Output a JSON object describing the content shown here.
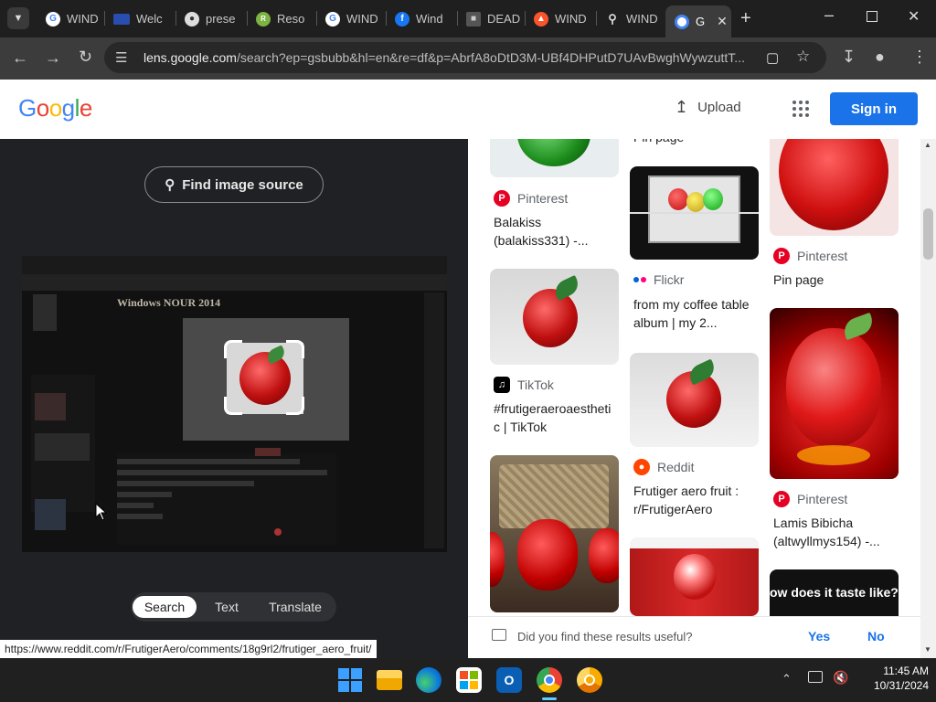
{
  "browser": {
    "tabs": [
      {
        "label": "WIND",
        "icon": "google-icon"
      },
      {
        "label": "Welc",
        "icon": "site-icon"
      },
      {
        "label": "prese",
        "icon": "globe-icon"
      },
      {
        "label": "Reso",
        "icon": "site-icon"
      },
      {
        "label": "WIND",
        "icon": "google-icon"
      },
      {
        "label": "Wind",
        "icon": "facebook-icon"
      },
      {
        "label": "DEAD",
        "icon": "site-icon"
      },
      {
        "label": "WIND",
        "icon": "brave-icon"
      },
      {
        "label": "WIND",
        "icon": "search-icon"
      },
      {
        "label": "G",
        "icon": "google-lens-icon",
        "active": true
      }
    ],
    "url_host": "lens.google.com",
    "url_path": "/search?ep=gsbubb&hl=en&re=df&p=AbrfA8oDtD3M-UBf4DHPutD7UAvBwghWywzuttT..."
  },
  "header": {
    "logo": "Google",
    "upload_label": "Upload",
    "signin_label": "Sign in"
  },
  "lens": {
    "find_source_label": "Find image source",
    "modes": [
      "Search",
      "Text",
      "Translate"
    ],
    "active_mode": "Search",
    "preview_window_title": "Windows NOUR 2014"
  },
  "results": {
    "col1": [
      {
        "source": "Pinterest",
        "title": "Balakiss (balakiss331) -..."
      },
      {
        "source": "TikTok",
        "title": "#frutigeraeroaesthetic | TikTok"
      }
    ],
    "col2": [
      {
        "title_partial": "Pin page"
      },
      {
        "source": "Flickr",
        "title": "from my coffee table album | my 2..."
      },
      {
        "source": "Reddit",
        "title": "Frutiger aero fruit : r/FrutigerAero"
      }
    ],
    "col3": [
      {
        "source": "Pinterest",
        "title": "Pin page"
      },
      {
        "source": "Pinterest",
        "title": "Lamis Bibicha (altwyllmys154) -..."
      },
      {
        "image_text": "ow does it taste like?"
      }
    ],
    "feedback_question": "Did you find these results useful?",
    "feedback_yes": "Yes",
    "feedback_no": "No"
  },
  "status_url": "https://www.reddit.com/r/FrutigerAero/comments/18g9rl2/frutiger_aero_fruit/",
  "taskbar": {
    "time": "11:45 AM",
    "date": "10/31/2024"
  },
  "colors": {
    "accent": "#1a73e8",
    "pinterest": "#e60023",
    "reddit": "#ff4500"
  }
}
